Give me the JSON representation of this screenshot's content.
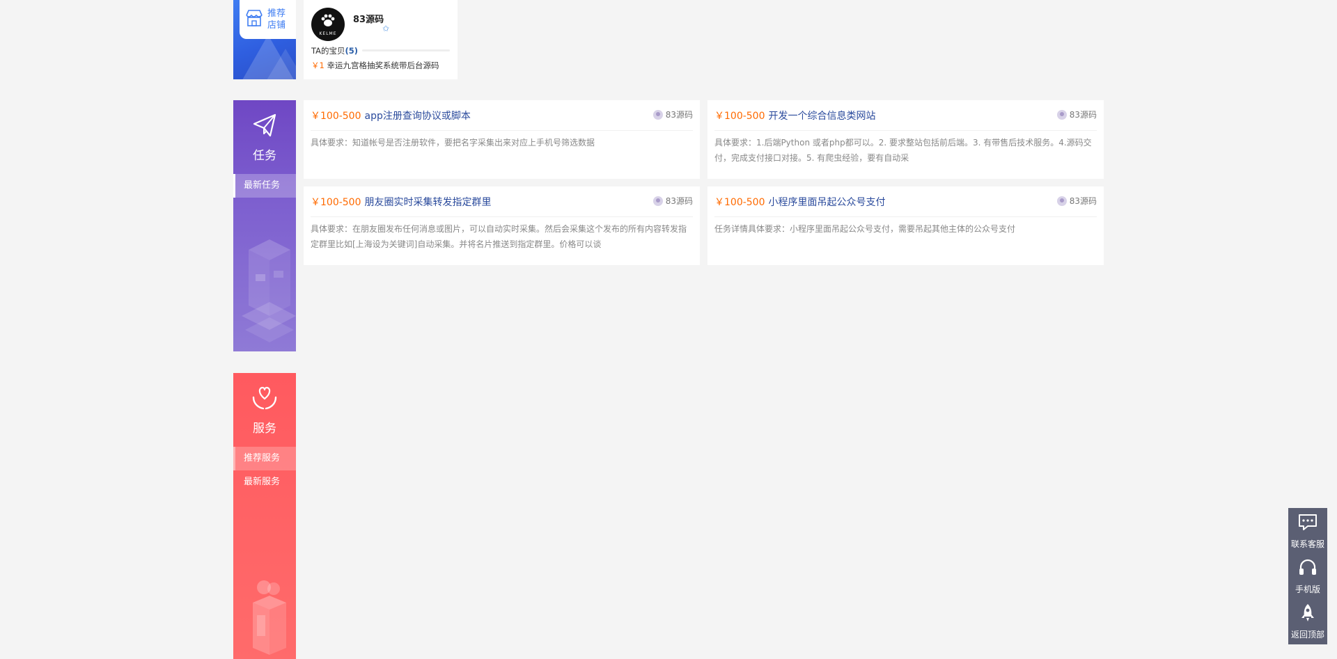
{
  "store_section": {
    "tag_label": "推荐店铺",
    "card": {
      "logo_text": "KELME",
      "name": "83源码",
      "items_label": "TA的宝贝",
      "items_count": "(5)",
      "product_price": "￥1",
      "product_name": "幸运九宫格抽奖系统带后台源码"
    }
  },
  "task_section": {
    "label": "任务",
    "nav": [
      {
        "label": "最新任务",
        "active": true
      }
    ],
    "cards": [
      {
        "price": "￥100-500",
        "title": "app注册查询协议或脚本",
        "owner": "83源码",
        "desc": "具体要求：知道帐号是否注册软件，要把名字采集出来对应上手机号筛选数据"
      },
      {
        "price": "￥100-500",
        "title": "开发一个综合信息类网站",
        "owner": "83源码",
        "desc": "具体要求：1.后端Python 或者php都可以。2. 要求整站包括前后端。3. 有带售后技术服务。4.源码交付，完成支付接口对接。5. 有爬虫经验，要有自动采"
      },
      {
        "price": "￥100-500",
        "title": "朋友圈实时采集转发指定群里",
        "owner": "83源码",
        "desc": "具体要求：在朋友圈发布任何消息或图片，可以自动实时采集。然后会采集这个发布的所有内容转发指定群里比如[上海设为关键词]自动采集。并将名片推送到指定群里。价格可以谈"
      },
      {
        "price": "￥100-500",
        "title": "小程序里面吊起公众号支付",
        "owner": "83源码",
        "desc": "任务详情具体要求：小程序里面吊起公众号支付，需要吊起其他主体的公众号支付"
      }
    ]
  },
  "service_section": {
    "label": "服务",
    "nav": [
      {
        "label": "推荐服务",
        "active": true
      },
      {
        "label": "最新服务",
        "active": false
      }
    ]
  },
  "float_toolbar": {
    "items": [
      {
        "label": "联系客服",
        "icon": "chat-icon"
      },
      {
        "label": "手机版",
        "icon": "headset-icon"
      },
      {
        "label": "返回顶部",
        "icon": "rocket-icon"
      }
    ]
  },
  "colors": {
    "store_blue": "#3f7df2",
    "task_purple": "#6f47c4",
    "service_red": "#ff5a5f",
    "price_orange": "#ff6a00",
    "title_blue": "#2a4a9c",
    "toolbar_gray": "#5b5f73"
  }
}
